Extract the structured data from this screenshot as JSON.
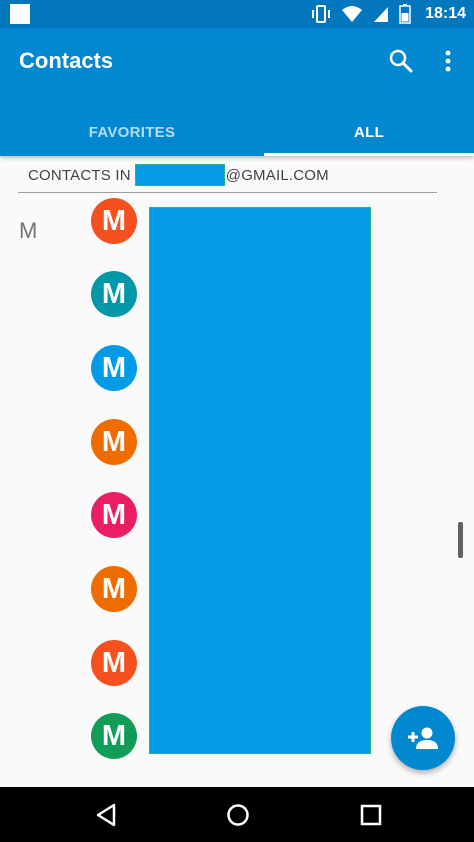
{
  "status_bar": {
    "time": "18:14",
    "icons": [
      "notification-square-icon",
      "vibrate-icon",
      "wifi-icon",
      "signal-icon",
      "battery-icon"
    ]
  },
  "app_bar": {
    "title": "Contacts",
    "icons": [
      "search-icon",
      "more-vert-icon"
    ],
    "tabs": [
      {
        "label": "FAVORITES",
        "active": false
      },
      {
        "label": "ALL",
        "active": true
      }
    ]
  },
  "account_header": {
    "prefix": "CONTACTS IN",
    "suffix": "@GMAIL.COM"
  },
  "section_letter": "M",
  "contacts": [
    {
      "initial": "M",
      "color": "#f4511e"
    },
    {
      "initial": "M",
      "color": "#0097a7"
    },
    {
      "initial": "M",
      "color": "#039be5"
    },
    {
      "initial": "M",
      "color": "#ef6c00"
    },
    {
      "initial": "M",
      "color": "#e91e63"
    },
    {
      "initial": "M",
      "color": "#ef6c00"
    },
    {
      "initial": "M",
      "color": "#f4511e"
    },
    {
      "initial": "M",
      "color": "#0f9d58"
    }
  ],
  "fab": {
    "icon": "add-contact-icon",
    "color": "#0288d1"
  },
  "nav_bar": {
    "icons": [
      "back-icon",
      "home-icon",
      "recents-icon"
    ]
  },
  "colors": {
    "primary": "#0288d1",
    "primary_dark": "#0277bd",
    "redaction": "#039be5"
  }
}
